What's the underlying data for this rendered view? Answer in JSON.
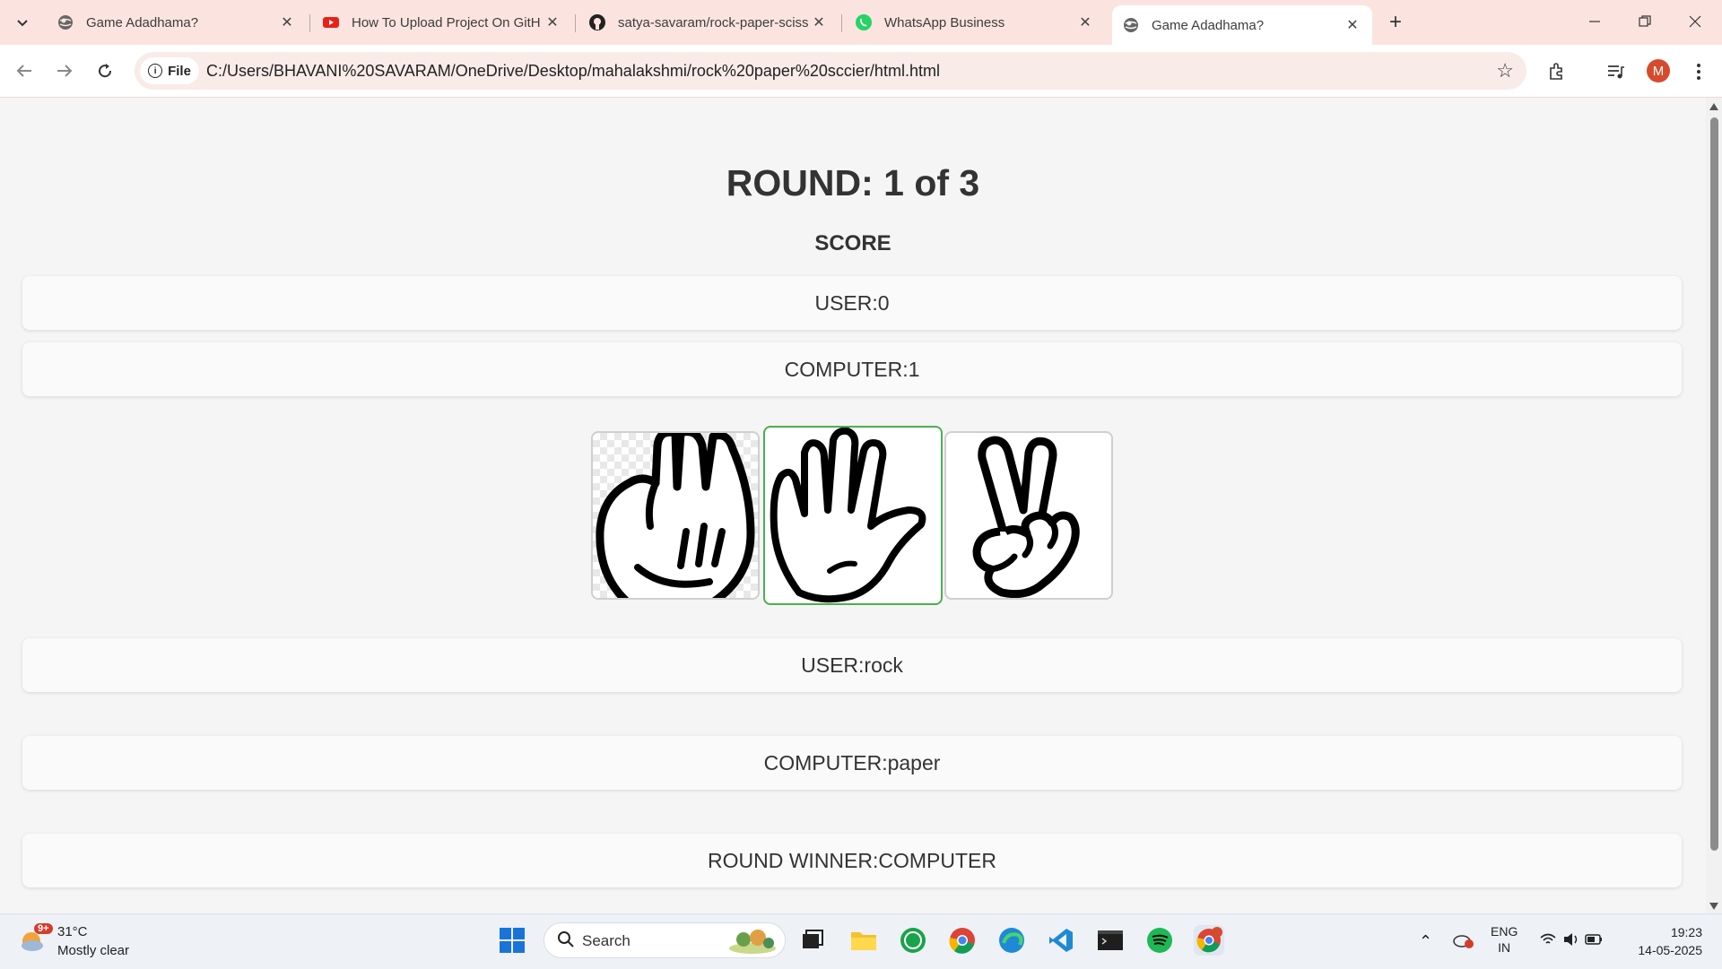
{
  "browser": {
    "tabs": [
      {
        "title": "Game Adadhama?",
        "icon": "globe-icon",
        "active": false
      },
      {
        "title": "How To Upload Project On GitH",
        "icon": "youtube-icon",
        "active": false
      },
      {
        "title": "satya-savaram/rock-paper-sciss",
        "icon": "github-icon",
        "active": false
      },
      {
        "title": "WhatsApp Business",
        "icon": "whatsapp-icon",
        "active": false
      },
      {
        "title": "Game Adadhama?",
        "icon": "globe-icon",
        "active": true
      }
    ],
    "file_chip": "File",
    "url": "C:/Users/BHAVANI%20SAVARAM/OneDrive/Desktop/mahalakshmi/rock%20paper%20sccier/html.html",
    "profile_initial": "M"
  },
  "game": {
    "round": "ROUND: 1 of 3",
    "score_heading": "SCORE",
    "user_score": "USER:0",
    "computer_score": "COMPUTER:1",
    "choices": [
      "rock",
      "paper",
      "scissors"
    ],
    "selected_choice": "paper",
    "user_choice": "USER:rock",
    "computer_choice": "COMPUTER:paper",
    "round_winner": "ROUND WINNER:COMPUTER"
  },
  "taskbar": {
    "weather_temp": "31°C",
    "weather_desc": "Mostly clear",
    "weather_badge": "9+",
    "search_label": "Search",
    "lang_top": "ENG",
    "lang_bottom": "IN",
    "time": "19:23",
    "date": "14-05-2025",
    "apps": [
      "task-view",
      "file-explorer",
      "whatsapp",
      "chrome",
      "edge",
      "vscode",
      "terminal",
      "spotify",
      "chrome-profile"
    ]
  },
  "colors": {
    "tabbar_bg": "#fbe4df",
    "selected_border": "#4caf50",
    "page_bg": "#f5f5f5"
  }
}
